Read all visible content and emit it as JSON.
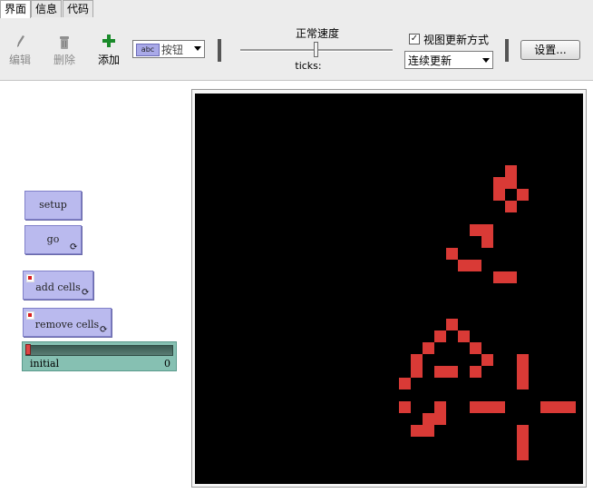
{
  "tabs": [
    {
      "label": "界面",
      "active": true
    },
    {
      "label": "信息",
      "active": false
    },
    {
      "label": "代码",
      "active": false
    }
  ],
  "toolbar": {
    "edit_label": "编辑",
    "delete_label": "删除",
    "add_label": "添加",
    "widget_type_chip": "abc",
    "widget_type": "按钮",
    "speed_label": "正常速度",
    "speed_value": 0.5,
    "ticks_label": "ticks:",
    "view_updates_label": "视图更新方式",
    "view_updates_checked": true,
    "update_mode": "连续更新",
    "settings_label": "设置..."
  },
  "widgets": {
    "setup": {
      "label": "setup"
    },
    "go": {
      "label": "go",
      "forever": true
    },
    "add_cells": {
      "label": "add cells",
      "forever": true
    },
    "remove_cells": {
      "label": "remove cells",
      "forever": true
    },
    "initial_slider": {
      "label": "initial",
      "value": "0",
      "fraction": 0
    }
  },
  "icons": {
    "edit": "pencil-icon",
    "delete": "trash-icon",
    "add": "plus-icon",
    "forever": "forever-icon"
  },
  "colors": {
    "button_bg": "#babaee",
    "slider_bg": "#86c0b2",
    "world_bg": "#000000",
    "cell_color": "#d93a36",
    "add_icon": "#1a8a2a"
  },
  "world_cells": [
    [
      18,
      6
    ],
    [
      17,
      7
    ],
    [
      18,
      7
    ],
    [
      17,
      8
    ],
    [
      19,
      8
    ],
    [
      18,
      9
    ],
    [
      15,
      11
    ],
    [
      16,
      11
    ],
    [
      16,
      12
    ],
    [
      13,
      13
    ],
    [
      14,
      14
    ],
    [
      15,
      14
    ],
    [
      17,
      15
    ],
    [
      18,
      15
    ],
    [
      25,
      12
    ],
    [
      27,
      12
    ],
    [
      25,
      13
    ],
    [
      27,
      13
    ],
    [
      26,
      14
    ],
    [
      13,
      19
    ],
    [
      12,
      20
    ],
    [
      14,
      20
    ],
    [
      11,
      21
    ],
    [
      15,
      21
    ],
    [
      10,
      22
    ],
    [
      16,
      22
    ],
    [
      10,
      23
    ],
    [
      12,
      23
    ],
    [
      13,
      23
    ],
    [
      15,
      23
    ],
    [
      19,
      22
    ],
    [
      19,
      23
    ],
    [
      9,
      24
    ],
    [
      19,
      24
    ],
    [
      9,
      26
    ],
    [
      12,
      26
    ],
    [
      15,
      26
    ],
    [
      16,
      26
    ],
    [
      17,
      26
    ],
    [
      21,
      26
    ],
    [
      22,
      26
    ],
    [
      23,
      26
    ],
    [
      11,
      27
    ],
    [
      12,
      27
    ],
    [
      10,
      28
    ],
    [
      11,
      28
    ],
    [
      19,
      28
    ],
    [
      19,
      29
    ],
    [
      19,
      30
    ]
  ]
}
